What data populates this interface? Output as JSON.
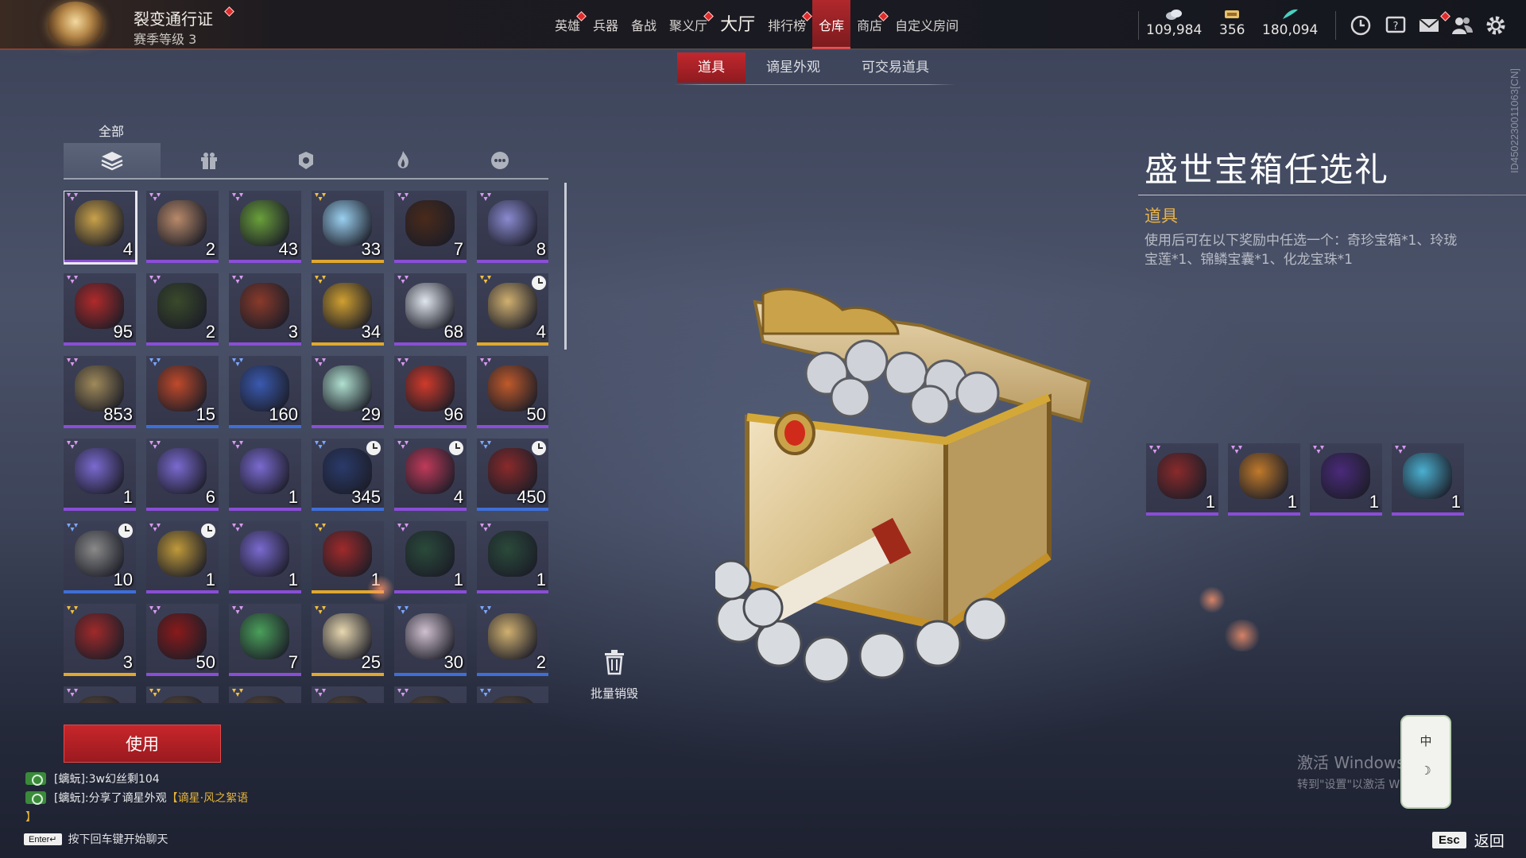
{
  "header": {
    "pass_title": "裂变通行证",
    "season_level": "赛季等级 3"
  },
  "nav": [
    {
      "label": "英雄",
      "badge": true,
      "active": false,
      "big": false
    },
    {
      "label": "兵器",
      "badge": false,
      "active": false,
      "big": false
    },
    {
      "label": "备战",
      "badge": false,
      "active": false,
      "big": false
    },
    {
      "label": "聚义厅",
      "badge": true,
      "active": false,
      "big": false
    },
    {
      "label": "大厅",
      "badge": false,
      "active": false,
      "big": true
    },
    {
      "label": "排行榜",
      "badge": true,
      "active": false,
      "big": false
    },
    {
      "label": "仓库",
      "badge": false,
      "active": true,
      "big": false
    },
    {
      "label": "商店",
      "badge": true,
      "active": false,
      "big": false
    },
    {
      "label": "自定义房间",
      "badge": false,
      "active": false,
      "big": false
    }
  ],
  "currencies": [
    {
      "icon": "coin-stack-icon",
      "value": "109,984"
    },
    {
      "icon": "ticket-icon",
      "value": "356"
    },
    {
      "icon": "feather-icon",
      "value": "180,094"
    }
  ],
  "top_icons": [
    "timer-icon",
    "help-icon",
    "mail-icon",
    "friends-icon",
    "settings-icon"
  ],
  "subtabs": [
    {
      "label": "道具",
      "active": true
    },
    {
      "label": "谪星外观",
      "active": false
    },
    {
      "label": "可交易道具",
      "active": false
    }
  ],
  "category": {
    "label": "全部",
    "tabs": [
      "all-items-icon",
      "gift-icon",
      "token-icon",
      "flame-icon",
      "more-icon"
    ]
  },
  "inventory": [
    {
      "qty": "4",
      "rarity": "purple",
      "selected": true,
      "color": "#c9a24a"
    },
    {
      "qty": "2",
      "rarity": "purple",
      "color": "#b98a6a"
    },
    {
      "qty": "43",
      "rarity": "purple",
      "color": "#6aa03a"
    },
    {
      "qty": "33",
      "rarity": "gold",
      "color": "#9ad0f0",
      "gold": true
    },
    {
      "qty": "7",
      "rarity": "purple",
      "color": "#4a2a1a"
    },
    {
      "qty": "8",
      "rarity": "purple",
      "color": "#8a8ad0"
    },
    {
      "qty": "95",
      "rarity": "purple",
      "color": "#b02a2a"
    },
    {
      "qty": "2",
      "rarity": "purple",
      "color": "#3a4a2a"
    },
    {
      "qty": "3",
      "rarity": "purple",
      "color": "#8a3a2a"
    },
    {
      "qty": "34",
      "rarity": "gold",
      "color": "#d0a030"
    },
    {
      "qty": "68",
      "rarity": "purple",
      "color": "#e0e6ee"
    },
    {
      "qty": "4",
      "rarity": "gold",
      "color": "#d0b070",
      "gold": true,
      "clock": true
    },
    {
      "qty": "853",
      "rarity": "purple",
      "color": "#a08a5a"
    },
    {
      "qty": "15",
      "rarity": "blue",
      "color": "#c04a2a",
      "blue": true
    },
    {
      "qty": "160",
      "rarity": "blue",
      "color": "#3a5ab0",
      "blue": true
    },
    {
      "qty": "29",
      "rarity": "purple",
      "color": "#b0e0d0"
    },
    {
      "qty": "96",
      "rarity": "purple",
      "color": "#d03a2a"
    },
    {
      "qty": "50",
      "rarity": "purple",
      "color": "#c05a2a"
    },
    {
      "qty": "1",
      "rarity": "purple",
      "color": "#7a6ad0"
    },
    {
      "qty": "6",
      "rarity": "purple",
      "color": "#7a6ad0"
    },
    {
      "qty": "1",
      "rarity": "purple",
      "color": "#7a6ad0"
    },
    {
      "qty": "345",
      "rarity": "blue",
      "color": "#2a3a6a",
      "blue": true,
      "clock": true
    },
    {
      "qty": "4",
      "rarity": "purple",
      "color": "#c03a5a",
      "clock": true
    },
    {
      "qty": "450",
      "rarity": "blue",
      "color": "#8a2a2a",
      "blue": true,
      "clock": true
    },
    {
      "qty": "10",
      "rarity": "blue",
      "color": "#8a8a8a",
      "blue": true,
      "clock": true
    },
    {
      "qty": "1",
      "rarity": "purple",
      "color": "#c09a3a",
      "clock": true
    },
    {
      "qty": "1",
      "rarity": "purple",
      "color": "#7a6ad0"
    },
    {
      "qty": "1",
      "rarity": "gold",
      "color": "#a02a2a",
      "gold": true
    },
    {
      "qty": "1",
      "rarity": "purple",
      "color": "#2a4a3a"
    },
    {
      "qty": "1",
      "rarity": "purple",
      "color": "#2a4a3a"
    },
    {
      "qty": "3",
      "rarity": "gold",
      "color": "#a02a2a",
      "gold": true
    },
    {
      "qty": "50",
      "rarity": "purple",
      "color": "#8a1a1a"
    },
    {
      "qty": "7",
      "rarity": "purple",
      "color": "#4aa05a"
    },
    {
      "qty": "25",
      "rarity": "gold",
      "color": "#e8d8b0",
      "gold": true
    },
    {
      "qty": "30",
      "rarity": "blue",
      "color": "#d0c0d0",
      "blue": true
    },
    {
      "qty": "2",
      "rarity": "blue",
      "color": "#d0b070",
      "blue": true
    },
    {
      "qty": "",
      "rarity": "purple",
      "color": "#5a4a3a"
    },
    {
      "qty": "",
      "rarity": "gold",
      "color": "#5a4a3a",
      "gold": true
    },
    {
      "qty": "",
      "rarity": "gold",
      "color": "#5a4a3a",
      "gold": true
    },
    {
      "qty": "",
      "rarity": "purple",
      "color": "#5a4a3a"
    },
    {
      "qty": "",
      "rarity": "purple",
      "color": "#5a4a3a"
    },
    {
      "qty": "",
      "rarity": "blue",
      "color": "#5a4a3a",
      "blue": true
    }
  ],
  "batch_destroy_label": "批量销毁",
  "use_button": "使用",
  "chat": {
    "line1": "[螭蚖]:3w幻丝剩104",
    "line2_prefix": "[螭蚖]:分享了谪星外观",
    "line2_item": "【谪星·风之絮语",
    "line3": "】",
    "enter_key": "Enter↵",
    "enter_hint": "按下回车键开始聊天"
  },
  "detail": {
    "title": "盛世宝箱任选礼",
    "type": "道具",
    "description": "使用后可在以下奖励中任选一个：奇珍宝箱*1、玲珑宝莲*1、锦鳞宝囊*1、化龙宝珠*1",
    "rewards": [
      {
        "qty": "1",
        "color": "#8a2a2a"
      },
      {
        "qty": "1",
        "color": "#c07a2a"
      },
      {
        "qty": "1",
        "color": "#4a2a7a"
      },
      {
        "qty": "1",
        "color": "#4ab0d0"
      }
    ]
  },
  "side_id": "ID4502230011063[CN]",
  "windows_activation": {
    "line1": "激活 Windows",
    "line2": "转到\"设置\"以激活 Windows。"
  },
  "ime": {
    "label": "中",
    "mode": "☽"
  },
  "esc": {
    "key": "Esc",
    "label": "返回"
  }
}
